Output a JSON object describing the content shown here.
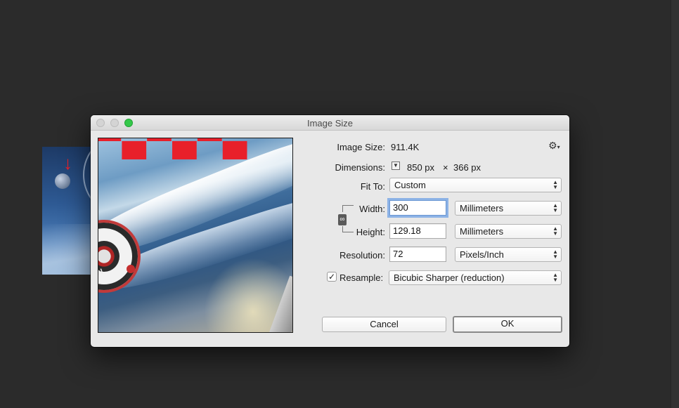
{
  "dialog": {
    "title": "Image Size",
    "image_size_label": "Image Size:",
    "image_size_value": "911.4K",
    "dimensions_label": "Dimensions:",
    "dimensions_width": "850 px",
    "dimensions_sep": "×",
    "dimensions_height": "366 px",
    "fit_to_label": "Fit To:",
    "fit_to_value": "Custom",
    "width_label": "Width:",
    "width_value": "300",
    "width_unit": "Millimeters",
    "height_label": "Height:",
    "height_value": "129.18",
    "height_unit": "Millimeters",
    "resolution_label": "Resolution:",
    "resolution_value": "72",
    "resolution_unit": "Pixels/Inch",
    "resample_label": "Resample:",
    "resample_checked": true,
    "resample_value": "Bicubic Sharper (reduction)",
    "cancel_label": "Cancel",
    "ok_label": "OK"
  },
  "icons": {
    "gear": "gear-icon",
    "constrain": "chain-link-icon",
    "dimensions_toggle": "dropdown-triangle-icon",
    "select_arrows": "up-down-chevron-icon",
    "checkbox": "checkmark-icon"
  },
  "colors": {
    "window_background": "#2b2b2b",
    "dialog_background": "#e8e8e8",
    "focus_ring": "#8db3e6",
    "zoom_button": "#35c84a",
    "artwork_red": "#e8202a"
  }
}
